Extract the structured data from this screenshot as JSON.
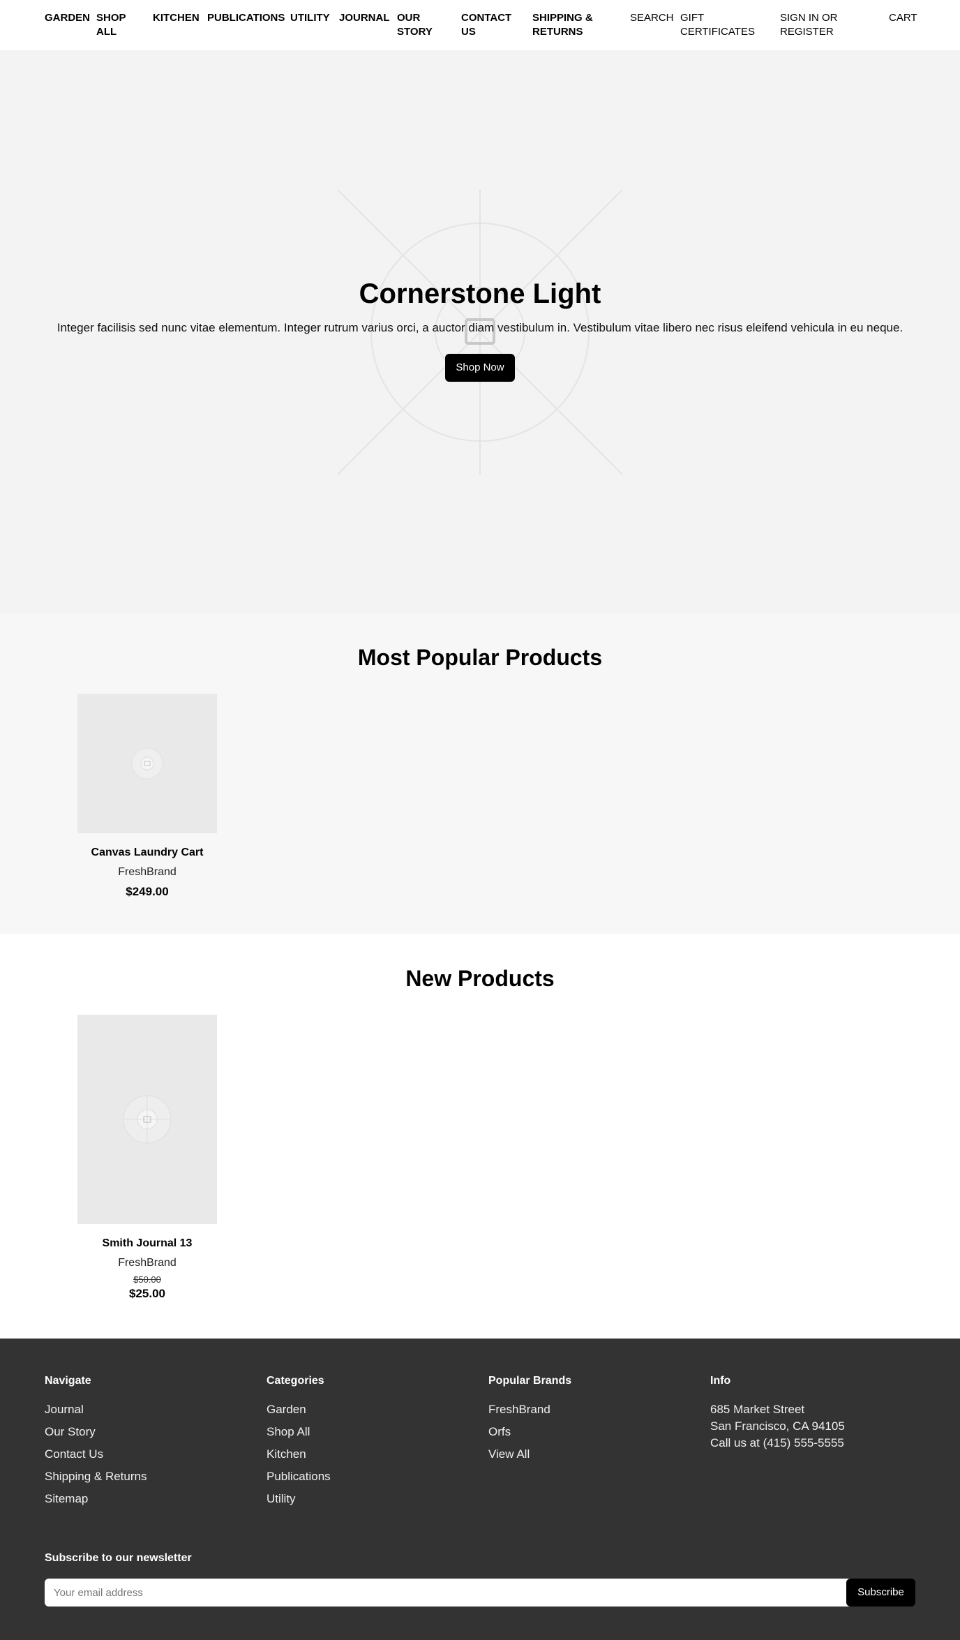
{
  "nav": {
    "garden": "GARDEN",
    "shop_all": "SHOP ALL",
    "kitchen": "KITCHEN",
    "publications": "PUBLICATIONS",
    "utility": "UTILITY",
    "journal": "JOURNAL",
    "our_story": "OUR STORY",
    "contact_us": "CONTACT US",
    "shipping_returns": "SHIPPING & RETURNS",
    "search": "SEARCH",
    "gift_certificates": "GIFT CERTIFICATES",
    "sign_in": "SIGN IN OR REGISTER",
    "cart": "CART"
  },
  "hero": {
    "title": "Cornerstone Light",
    "text": "Integer facilisis sed nunc vitae elementum. Integer rutrum varius orci, a auctor diam vestibulum in. Vestibulum vitae libero nec risus eleifend vehicula in eu neque.",
    "button": "Shop Now",
    "image_icon": "image-placeholder-icon"
  },
  "popular": {
    "title": "Most Popular Products",
    "products": [
      {
        "name": "Canvas Laundry Cart",
        "brand": "FreshBrand",
        "price": "$249.00"
      }
    ]
  },
  "new_products": {
    "title": "New Products",
    "products": [
      {
        "name": "Smith Journal 13",
        "brand": "FreshBrand",
        "old_price": "$50.00",
        "price": "$25.00"
      }
    ]
  },
  "footer": {
    "navigate": {
      "title": "Navigate",
      "links": [
        "Journal",
        "Our Story",
        "Contact Us",
        "Shipping & Returns",
        "Sitemap"
      ]
    },
    "categories": {
      "title": "Categories",
      "links": [
        "Garden",
        "Shop All",
        "Kitchen",
        "Publications",
        "Utility"
      ]
    },
    "brands": {
      "title": "Popular Brands",
      "links": [
        "FreshBrand",
        "Orfs",
        "View All"
      ]
    },
    "info": {
      "title": "Info",
      "lines": [
        "685 Market Street",
        "San Francisco, CA 94105",
        "Call us at (415) 555-5555"
      ]
    },
    "newsletter": {
      "title": "Subscribe to our newsletter",
      "placeholder": "Your email address",
      "button": "Subscribe"
    }
  },
  "colors": {
    "hero_bg": "#f3f3f3",
    "popular_bg": "#f7f7f7",
    "footer_bg": "#333333",
    "button_bg": "#000000"
  }
}
